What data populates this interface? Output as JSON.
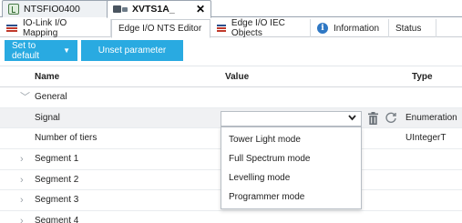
{
  "doc_tabs": [
    {
      "label": "NTSFIO0400"
    },
    {
      "label": "XVTS1A_",
      "close": "✕"
    }
  ],
  "editor_tabs": [
    {
      "label": "IO-Link I/O Mapping"
    },
    {
      "label": "Edge I/O NTS Editor"
    },
    {
      "label": "Edge I/O IEC Objects"
    },
    {
      "label": "Information"
    },
    {
      "label": "Status"
    }
  ],
  "toolbar": {
    "set_default_label": "Set to default",
    "unset_label": "Unset parameter"
  },
  "grid": {
    "headers": {
      "name": "Name",
      "value": "Value",
      "type": "Type"
    },
    "group": {
      "label": "General"
    },
    "rows": [
      {
        "name": "Signal",
        "type": "Enumeration"
      },
      {
        "name": "Number of tiers",
        "type": "UIntegerT"
      },
      {
        "name": "Segment 1"
      },
      {
        "name": "Segment 2"
      },
      {
        "name": "Segment 3"
      },
      {
        "name": "Segment 4"
      }
    ]
  },
  "dropdown": {
    "options": [
      "Tower Light mode",
      "Full Spectrum mode",
      "Levelling mode",
      "Programmer mode"
    ]
  },
  "colors": {
    "accent": "#29aae1",
    "selected_row": "#f0f1f3"
  }
}
